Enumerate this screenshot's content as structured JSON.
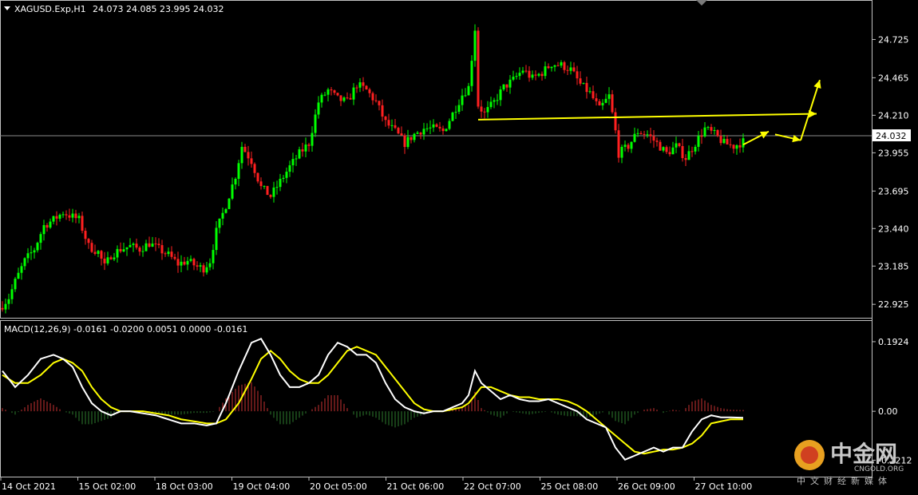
{
  "header": {
    "symbol": "XAGUSD.Exp,H1",
    "ohlc": "24.073 24.085 23.995 24.032"
  },
  "macd_header": {
    "label": "MACD(12,26,9) -0.0161 -0.0200 0.0051 0.0000 -0.0161"
  },
  "price_axis": {
    "ticks": [
      "24.725",
      "24.465",
      "24.210",
      "23.955",
      "23.695",
      "23.440",
      "23.185",
      "22.925"
    ],
    "current_price": "24.032"
  },
  "macd_axis": {
    "ticks": [
      "0.1924",
      "0.00",
      "-0.1212"
    ]
  },
  "time_axis": {
    "labels": [
      "14 Oct 2021",
      "15 Oct 02:00",
      "18 Oct 03:00",
      "19 Oct 04:00",
      "20 Oct 05:00",
      "21 Oct 06:00",
      "22 Oct 07:00",
      "25 Oct 08:00",
      "26 Oct 09:00",
      "27 Oct 10:00"
    ]
  },
  "watermark": {
    "brand": "中金网",
    "site": "CNGOLD.ORG",
    "tagline": "中文财经新媒体"
  },
  "colors": {
    "background": "#000000",
    "bull": "#00ff00",
    "bear": "#ff2020",
    "macd_line": "#ffffff",
    "signal_line": "#ffff00",
    "hist_pos": "#c83232",
    "hist_neg": "#2e7d2e",
    "annotation": "#ffff00",
    "grid": "#c0c0c0"
  },
  "chart_data": [
    {
      "type": "candlestick",
      "symbol": "XAGUSD.Exp",
      "timeframe": "H1",
      "y_range": [
        22.85,
        24.95
      ],
      "x_labels": [
        "14 Oct 2021",
        "15 Oct 02:00",
        "18 Oct 03:00",
        "19 Oct 04:00",
        "20 Oct 05:00",
        "21 Oct 06:00",
        "22 Oct 07:00",
        "25 Oct 08:00",
        "26 Oct 09:00",
        "27 Oct 10:00"
      ],
      "close_path": [
        [
          0,
          22.92
        ],
        [
          2,
          22.97
        ],
        [
          4,
          23.08
        ],
        [
          7,
          23.22
        ],
        [
          10,
          23.3
        ],
        [
          13,
          23.46
        ],
        [
          16,
          23.5
        ],
        [
          19,
          23.55
        ],
        [
          22,
          23.52
        ],
        [
          24,
          23.5
        ],
        [
          27,
          23.32
        ],
        [
          30,
          23.28
        ],
        [
          32,
          23.18
        ],
        [
          34,
          23.26
        ],
        [
          37,
          23.3
        ],
        [
          40,
          23.32
        ],
        [
          43,
          23.3
        ],
        [
          46,
          23.34
        ],
        [
          49,
          23.3
        ],
        [
          52,
          23.26
        ],
        [
          55,
          23.2
        ],
        [
          58,
          23.22
        ],
        [
          61,
          23.18
        ],
        [
          63,
          23.17
        ],
        [
          65,
          23.22
        ],
        [
          67,
          23.42
        ],
        [
          70,
          23.6
        ],
        [
          73,
          23.8
        ],
        [
          75,
          24.0
        ],
        [
          78,
          23.9
        ],
        [
          81,
          23.72
        ],
        [
          84,
          23.66
        ],
        [
          87,
          23.76
        ],
        [
          90,
          23.86
        ],
        [
          93,
          23.95
        ],
        [
          96,
          24.02
        ],
        [
          99,
          24.3
        ],
        [
          102,
          24.38
        ],
        [
          105,
          24.32
        ],
        [
          108,
          24.3
        ],
        [
          111,
          24.42
        ],
        [
          114,
          24.38
        ],
        [
          117,
          24.3
        ],
        [
          120,
          24.16
        ],
        [
          123,
          24.1
        ],
        [
          126,
          24.02
        ],
        [
          129,
          24.08
        ],
        [
          132,
          24.12
        ],
        [
          135,
          24.12
        ],
        [
          138,
          24.1
        ],
        [
          141,
          24.22
        ],
        [
          144,
          24.35
        ],
        [
          146,
          24.4
        ],
        [
          148,
          24.8
        ],
        [
          149,
          24.28
        ],
        [
          151,
          24.22
        ],
        [
          154,
          24.3
        ],
        [
          157,
          24.4
        ],
        [
          160,
          24.45
        ],
        [
          163,
          24.52
        ],
        [
          166,
          24.46
        ],
        [
          169,
          24.5
        ],
        [
          172,
          24.56
        ],
        [
          175,
          24.55
        ],
        [
          178,
          24.52
        ],
        [
          181,
          24.42
        ],
        [
          184,
          24.36
        ],
        [
          187,
          24.25
        ],
        [
          190,
          24.34
        ],
        [
          192,
          24.1
        ],
        [
          193,
          23.95
        ],
        [
          196,
          24.0
        ],
        [
          199,
          24.1
        ],
        [
          202,
          24.08
        ],
        [
          205,
          24.02
        ],
        [
          208,
          23.95
        ],
        [
          211,
          24.0
        ],
        [
          214,
          23.92
        ],
        [
          217,
          24.02
        ],
        [
          220,
          24.12
        ],
        [
          223,
          24.08
        ],
        [
          226,
          24.02
        ],
        [
          229,
          24.0
        ],
        [
          232,
          24.03
        ]
      ],
      "annotations": [
        {
          "type": "resistance-line",
          "from": [
            149,
            24.18
          ],
          "to": [
            255,
            24.22
          ]
        },
        {
          "type": "arrow",
          "from": [
            232,
            24.01
          ],
          "to": [
            240,
            24.1
          ]
        },
        {
          "type": "arrow",
          "from": [
            242,
            24.08
          ],
          "to": [
            250,
            24.04
          ]
        },
        {
          "type": "arrow",
          "from": [
            250,
            24.04
          ],
          "to": [
            256,
            24.45
          ]
        }
      ]
    },
    {
      "type": "line",
      "title": "MACD(12,26,9) -0.0161 -0.0200 0.0051 0.0000 -0.0161",
      "y_range": [
        -0.16,
        0.22
      ],
      "series": [
        {
          "name": "MACD",
          "values": [
            [
              0,
              0.1
            ],
            [
              4,
              0.06
            ],
            [
              8,
              0.09
            ],
            [
              12,
              0.13
            ],
            [
              16,
              0.14
            ],
            [
              19,
              0.13
            ],
            [
              22,
              0.11
            ],
            [
              25,
              0.06
            ],
            [
              28,
              0.02
            ],
            [
              31,
              0.0
            ],
            [
              34,
              -0.01
            ],
            [
              37,
              0.0
            ],
            [
              40,
              0.0
            ],
            [
              44,
              -0.005
            ],
            [
              48,
              -0.01
            ],
            [
              52,
              -0.02
            ],
            [
              56,
              -0.03
            ],
            [
              60,
              -0.03
            ],
            [
              64,
              -0.035
            ],
            [
              67,
              -0.03
            ],
            [
              70,
              0.02
            ],
            [
              74,
              0.1
            ],
            [
              78,
              0.17
            ],
            [
              81,
              0.18
            ],
            [
              84,
              0.14
            ],
            [
              87,
              0.09
            ],
            [
              90,
              0.06
            ],
            [
              93,
              0.06
            ],
            [
              96,
              0.07
            ],
            [
              99,
              0.09
            ],
            [
              102,
              0.14
            ],
            [
              105,
              0.17
            ],
            [
              108,
              0.16
            ],
            [
              111,
              0.14
            ],
            [
              114,
              0.14
            ],
            [
              117,
              0.12
            ],
            [
              120,
              0.07
            ],
            [
              123,
              0.03
            ],
            [
              126,
              0.01
            ],
            [
              129,
              0.0
            ],
            [
              132,
              -0.005
            ],
            [
              135,
              0.0
            ],
            [
              138,
              0.0
            ],
            [
              141,
              0.01
            ],
            [
              144,
              0.02
            ],
            [
              146,
              0.04
            ],
            [
              148,
              0.1
            ],
            [
              150,
              0.07
            ],
            [
              153,
              0.05
            ],
            [
              156,
              0.03
            ],
            [
              159,
              0.04
            ],
            [
              162,
              0.03
            ],
            [
              165,
              0.025
            ],
            [
              168,
              0.025
            ],
            [
              171,
              0.03
            ],
            [
              174,
              0.02
            ],
            [
              177,
              0.01
            ],
            [
              180,
              0.0
            ],
            [
              183,
              -0.02
            ],
            [
              186,
              -0.03
            ],
            [
              189,
              -0.04
            ],
            [
              192,
              -0.09
            ],
            [
              195,
              -0.12
            ],
            [
              198,
              -0.11
            ],
            [
              201,
              -0.1
            ],
            [
              204,
              -0.09
            ],
            [
              207,
              -0.1
            ],
            [
              210,
              -0.09
            ],
            [
              213,
              -0.09
            ],
            [
              216,
              -0.05
            ],
            [
              219,
              -0.02
            ],
            [
              222,
              -0.01
            ],
            [
              225,
              -0.015
            ],
            [
              228,
              -0.015
            ],
            [
              232,
              -0.016
            ]
          ]
        },
        {
          "name": "Signal",
          "values": [
            [
              0,
              0.09
            ],
            [
              4,
              0.07
            ],
            [
              8,
              0.07
            ],
            [
              12,
              0.09
            ],
            [
              16,
              0.12
            ],
            [
              19,
              0.13
            ],
            [
              22,
              0.12
            ],
            [
              25,
              0.1
            ],
            [
              28,
              0.06
            ],
            [
              31,
              0.03
            ],
            [
              34,
              0.01
            ],
            [
              37,
              0.0
            ],
            [
              40,
              0.0
            ],
            [
              44,
              0.0
            ],
            [
              48,
              -0.005
            ],
            [
              52,
              -0.01
            ],
            [
              56,
              -0.02
            ],
            [
              60,
              -0.025
            ],
            [
              64,
              -0.03
            ],
            [
              67,
              -0.03
            ],
            [
              70,
              -0.02
            ],
            [
              74,
              0.02
            ],
            [
              78,
              0.08
            ],
            [
              81,
              0.13
            ],
            [
              84,
              0.15
            ],
            [
              87,
              0.13
            ],
            [
              90,
              0.1
            ],
            [
              93,
              0.08
            ],
            [
              96,
              0.07
            ],
            [
              99,
              0.07
            ],
            [
              102,
              0.09
            ],
            [
              105,
              0.12
            ],
            [
              108,
              0.15
            ],
            [
              111,
              0.16
            ],
            [
              114,
              0.15
            ],
            [
              117,
              0.14
            ],
            [
              120,
              0.11
            ],
            [
              123,
              0.08
            ],
            [
              126,
              0.05
            ],
            [
              129,
              0.02
            ],
            [
              132,
              0.005
            ],
            [
              135,
              0.0
            ],
            [
              138,
              0.0
            ],
            [
              141,
              0.005
            ],
            [
              144,
              0.01
            ],
            [
              146,
              0.02
            ],
            [
              148,
              0.04
            ],
            [
              150,
              0.06
            ],
            [
              153,
              0.06
            ],
            [
              156,
              0.05
            ],
            [
              159,
              0.04
            ],
            [
              162,
              0.035
            ],
            [
              165,
              0.035
            ],
            [
              168,
              0.03
            ],
            [
              171,
              0.03
            ],
            [
              174,
              0.03
            ],
            [
              177,
              0.025
            ],
            [
              180,
              0.015
            ],
            [
              183,
              0.0
            ],
            [
              186,
              -0.02
            ],
            [
              189,
              -0.04
            ],
            [
              192,
              -0.06
            ],
            [
              195,
              -0.08
            ],
            [
              198,
              -0.1
            ],
            [
              201,
              -0.105
            ],
            [
              204,
              -0.1
            ],
            [
              207,
              -0.095
            ],
            [
              210,
              -0.095
            ],
            [
              213,
              -0.09
            ],
            [
              216,
              -0.08
            ],
            [
              219,
              -0.06
            ],
            [
              222,
              -0.03
            ],
            [
              225,
              -0.025
            ],
            [
              228,
              -0.02
            ],
            [
              232,
              -0.02
            ]
          ]
        }
      ],
      "histogram_note": "histogram equals MACD minus Signal"
    }
  ]
}
